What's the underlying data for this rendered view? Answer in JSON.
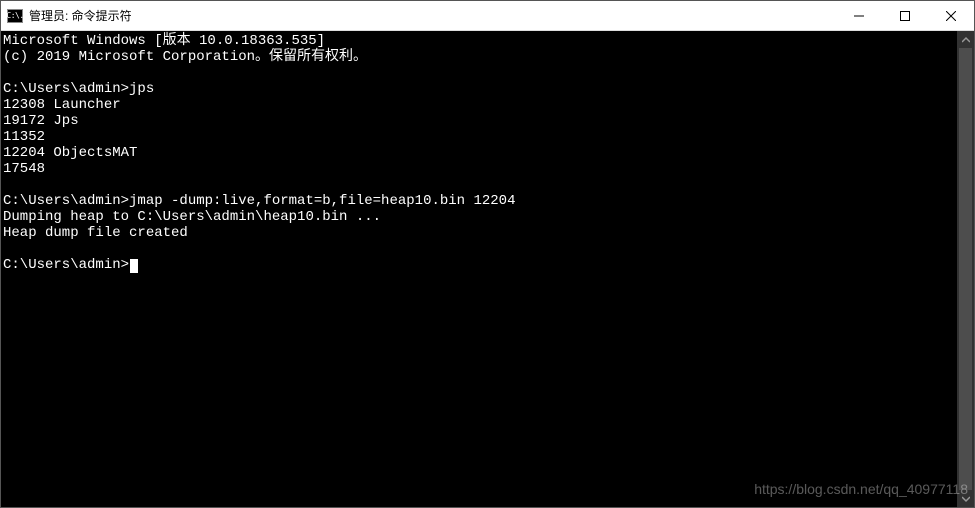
{
  "window": {
    "icon_label": "C:\\.",
    "title": "管理员: 命令提示符"
  },
  "terminal": {
    "lines": [
      "Microsoft Windows [版本 10.0.18363.535]",
      "(c) 2019 Microsoft Corporation。保留所有权利。",
      "",
      "C:\\Users\\admin>jps",
      "12308 Launcher",
      "19172 Jps",
      "11352",
      "12204 ObjectsMAT",
      "17548",
      "",
      "C:\\Users\\admin>jmap -dump:live,format=b,file=heap10.bin 12204",
      "Dumping heap to C:\\Users\\admin\\heap10.bin ...",
      "Heap dump file created",
      "",
      "C:\\Users\\admin>"
    ]
  },
  "watermark": "https://blog.csdn.net/qq_40977118"
}
